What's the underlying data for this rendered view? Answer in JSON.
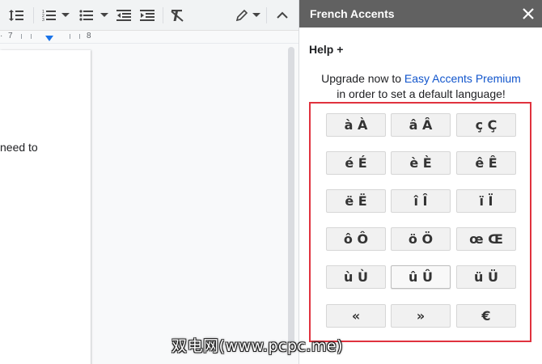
{
  "editor": {
    "toolbar": {
      "icons": [
        "line-spacing-icon",
        "numbered-list-icon",
        "bulleted-list-icon",
        "decrease-indent-icon",
        "increase-indent-icon",
        "clear-formatting-icon",
        "pencil-icon",
        "collapse-chevron-icon"
      ]
    },
    "ruler": {
      "label_7": "7",
      "label_8": "8"
    },
    "page": {
      "visible_text": "need to"
    }
  },
  "sidebar": {
    "title": "French Accents",
    "close_label": "✕",
    "help_label": "Help +",
    "upgrade": {
      "prefix": "Upgrade now to ",
      "link": "Easy Accents Premium",
      "suffix": " in order to set a default language!"
    },
    "accents": [
      [
        "à À",
        "â Â",
        "ç Ç"
      ],
      [
        "é É",
        "è È",
        "ê Ê"
      ],
      [
        "ë Ë",
        "î Î",
        "ï Ï"
      ],
      [
        "ô Ô",
        "ö Ö",
        "œ Œ"
      ],
      [
        "ù Ù",
        "û Û",
        "ü Ü"
      ],
      [
        "«",
        "»",
        "€"
      ]
    ],
    "colors": {
      "header": "#616161",
      "highlight_border": "#e0323e",
      "link": "#1155cc"
    }
  },
  "watermark": "双电网(www.pcpc.me)"
}
